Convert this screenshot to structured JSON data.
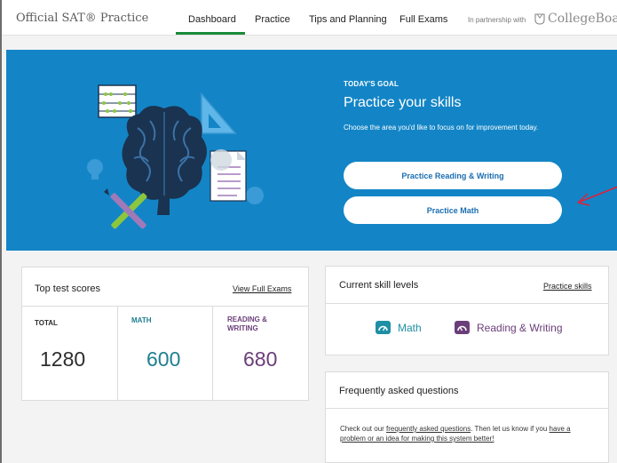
{
  "nav": {
    "brand": "Official SAT® Practice",
    "items": [
      {
        "label": "Dashboard",
        "active": true
      },
      {
        "label": "Practice",
        "active": false
      },
      {
        "label": "Tips and Planning",
        "active": false
      },
      {
        "label": "Full Exams",
        "active": false
      }
    ],
    "partner_text": "In partnership with",
    "partner_logo": "CollegeBoard"
  },
  "hero": {
    "kicker": "TODAY'S GOAL",
    "title": "Practice your skills",
    "description": "Choose the area you'd like to focus on for improvement today.",
    "buttons": [
      {
        "label": "Practice Reading & Writing"
      },
      {
        "label": "Practice Math"
      }
    ],
    "illustration_icon": "brain-study-illustration",
    "annotation_icon": "red-arrow-annotation"
  },
  "scores": {
    "title": "Top test scores",
    "link": "View Full Exams",
    "items": [
      {
        "label": "TOTAL",
        "value": "1280",
        "color": "#2d2d2d"
      },
      {
        "label": "MATH",
        "value": "600",
        "color": "#1f7f8f"
      },
      {
        "label": "READING & WRITING",
        "value": "680",
        "color": "#6b3e7a"
      }
    ]
  },
  "skills": {
    "title": "Current skill levels",
    "link": "Practice skills",
    "items": [
      {
        "label": "Math",
        "icon": "math-gauge-icon",
        "color": "#1e8fa4"
      },
      {
        "label": "Reading & Writing",
        "icon": "reading-gauge-icon",
        "color": "#6b3e7a"
      }
    ]
  },
  "faq": {
    "title": "Frequently asked questions",
    "text_1": "Check out our ",
    "link_1": "frequently asked questions",
    "text_2": ". Then let us know if you ",
    "link_2": "have a problem or an idea for making this system better!"
  },
  "colors": {
    "hero_bg": "#1385c6",
    "nav_active_underline": "#1a8a3a",
    "button_text": "#1b6eb1"
  }
}
